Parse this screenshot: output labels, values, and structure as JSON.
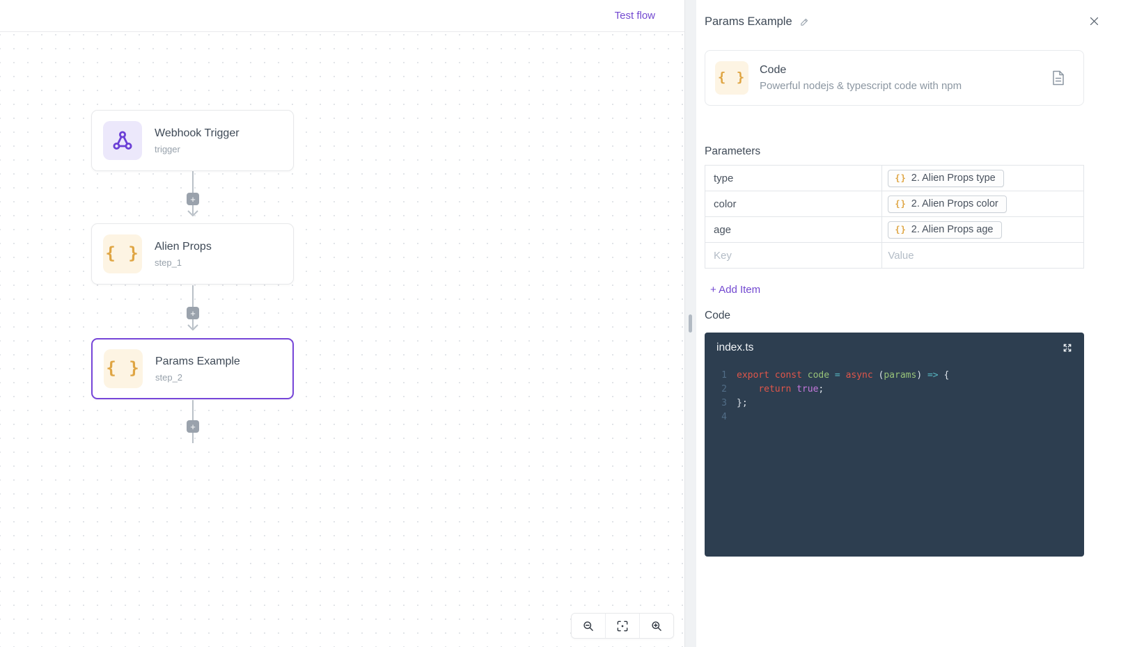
{
  "topbar": {
    "test_flow_label": "Test flow"
  },
  "canvas": {
    "nodes": [
      {
        "title": "Webhook Trigger",
        "subtitle": "trigger",
        "icon": "webhook-icon",
        "selected": false
      },
      {
        "title": "Alien Props",
        "subtitle": "step_1",
        "icon": "braces-icon",
        "selected": false
      },
      {
        "title": "Params Example",
        "subtitle": "step_2",
        "icon": "braces-icon",
        "selected": true
      }
    ],
    "braces_glyph": "{ }",
    "add_step_glyph": "+",
    "zoom_controls": [
      "zoom-out-icon",
      "fit-view-icon",
      "zoom-in-icon"
    ]
  },
  "panel": {
    "title": "Params Example",
    "close_icon": "close-icon",
    "edit_icon": "pencil-icon",
    "block_card": {
      "title": "Code",
      "subtitle": "Powerful nodejs & typescript code with npm",
      "right_icon": "document-icon"
    },
    "parameters": {
      "heading": "Parameters",
      "rows": [
        {
          "key": "type",
          "chip": "2. Alien Props type"
        },
        {
          "key": "color",
          "chip": "2. Alien Props color"
        },
        {
          "key": "age",
          "chip": "2. Alien Props age"
        }
      ],
      "chip_glyph": "{}",
      "new_row": {
        "key_placeholder": "Key",
        "value_placeholder": "Value"
      },
      "add_item_label": "+ Add Item"
    },
    "code_section": {
      "heading": "Code",
      "filename": "index.ts",
      "expand_icon": "expand-icon",
      "lines": [
        {
          "num": "1",
          "tokens": [
            [
              "export",
              "kw"
            ],
            [
              " ",
              "pl"
            ],
            [
              "const",
              "kw"
            ],
            [
              " ",
              "pl"
            ],
            [
              "code",
              "var"
            ],
            [
              " ",
              "pl"
            ],
            [
              "=",
              "op"
            ],
            [
              " ",
              "pl"
            ],
            [
              "async",
              "kw"
            ],
            [
              " ",
              "pl"
            ],
            [
              "(",
              "pl"
            ],
            [
              "params",
              "var"
            ],
            [
              ")",
              "pl"
            ],
            [
              " ",
              "pl"
            ],
            [
              "=>",
              "op"
            ],
            [
              " ",
              "pl"
            ],
            [
              "{",
              "pl"
            ]
          ]
        },
        {
          "num": "2",
          "tokens": [
            [
              "    ",
              "pl"
            ],
            [
              "return",
              "kw"
            ],
            [
              " ",
              "pl"
            ],
            [
              "true",
              "bool"
            ],
            [
              ";",
              "pl"
            ]
          ]
        },
        {
          "num": "3",
          "tokens": [
            [
              "};",
              "pl"
            ]
          ]
        },
        {
          "num": "4",
          "tokens": []
        }
      ]
    }
  },
  "colors": {
    "accent": "#7248d0",
    "selected_node_border": "#7645d8",
    "webhook_icon_bg": "#ece8fb",
    "webhook_icon": "#6b3fd6",
    "braces_icon_bg": "#fdf4e3",
    "braces_icon": "#dfa543",
    "editor_bg": "#2d3e50",
    "code_keyword": "#e0564a",
    "code_variable": "#98c379",
    "code_operator": "#56b6c2",
    "code_boolean": "#c678dd",
    "code_line_number": "#516d87"
  }
}
